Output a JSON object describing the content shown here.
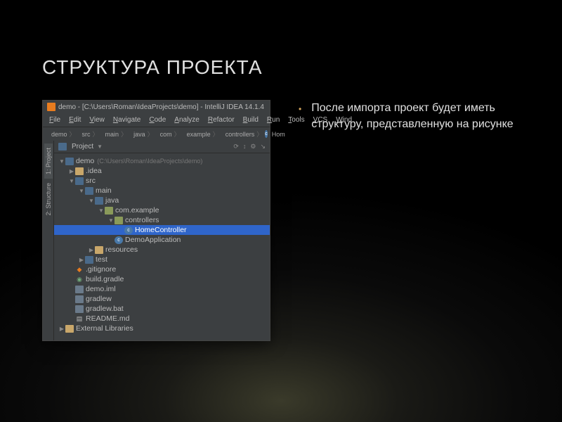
{
  "slide": {
    "title": "СТРУКТУРА ПРОЕКТА",
    "bullet": "После импорта проект будет иметь структуру, представленную на рисунке"
  },
  "ide": {
    "title": "demo - [C:\\Users\\Roman\\IdeaProjects\\demo] - IntelliJ IDEA 14.1.4",
    "menu": [
      "File",
      "Edit",
      "View",
      "Navigate",
      "Code",
      "Analyze",
      "Refactor",
      "Build",
      "Run",
      "Tools",
      "VCS",
      "Wind"
    ],
    "breadcrumb": {
      "items": [
        "demo",
        "src",
        "main",
        "java",
        "com",
        "example",
        "controllers"
      ],
      "tail": "Hom"
    },
    "panel": {
      "label": "Project",
      "icons": [
        "⟳",
        "↕",
        "⚙",
        "↘"
      ]
    },
    "sidebar_tabs": [
      "1: Project",
      "2: Structure"
    ],
    "tree": [
      {
        "d": 0,
        "chev": "down",
        "icon": "folder",
        "label": "demo",
        "hint": "(C:\\Users\\Roman\\IdeaProjects\\demo)"
      },
      {
        "d": 1,
        "chev": "right",
        "icon": "folder-y",
        "label": ".idea"
      },
      {
        "d": 1,
        "chev": "down",
        "icon": "folder",
        "label": "src"
      },
      {
        "d": 2,
        "chev": "down",
        "icon": "folder",
        "label": "main"
      },
      {
        "d": 3,
        "chev": "down",
        "icon": "folder",
        "label": "java"
      },
      {
        "d": 4,
        "chev": "down",
        "icon": "pkg",
        "label": "com.example"
      },
      {
        "d": 5,
        "chev": "down",
        "icon": "pkg",
        "label": "controllers"
      },
      {
        "d": 6,
        "chev": "none",
        "icon": "class",
        "label": "HomeController",
        "sel": true,
        "glyph": "c"
      },
      {
        "d": 5,
        "chev": "none",
        "icon": "class",
        "label": "DemoApplication",
        "glyph": "c"
      },
      {
        "d": 3,
        "chev": "right",
        "icon": "folder-y",
        "label": "resources"
      },
      {
        "d": 2,
        "chev": "right",
        "icon": "folder",
        "label": "test"
      },
      {
        "d": 1,
        "chev": "none",
        "icon": "git",
        "label": ".gitignore",
        "glyph": "◆"
      },
      {
        "d": 1,
        "chev": "none",
        "icon": "gradle",
        "label": "build.gradle",
        "glyph": "◉"
      },
      {
        "d": 1,
        "chev": "none",
        "icon": "file",
        "label": "demo.iml"
      },
      {
        "d": 1,
        "chev": "none",
        "icon": "file",
        "label": "gradlew"
      },
      {
        "d": 1,
        "chev": "none",
        "icon": "file",
        "label": "gradlew.bat"
      },
      {
        "d": 1,
        "chev": "none",
        "icon": "md",
        "label": "README.md",
        "glyph": "▤"
      },
      {
        "d": 0,
        "chev": "right",
        "icon": "lib",
        "label": "External Libraries"
      }
    ]
  }
}
